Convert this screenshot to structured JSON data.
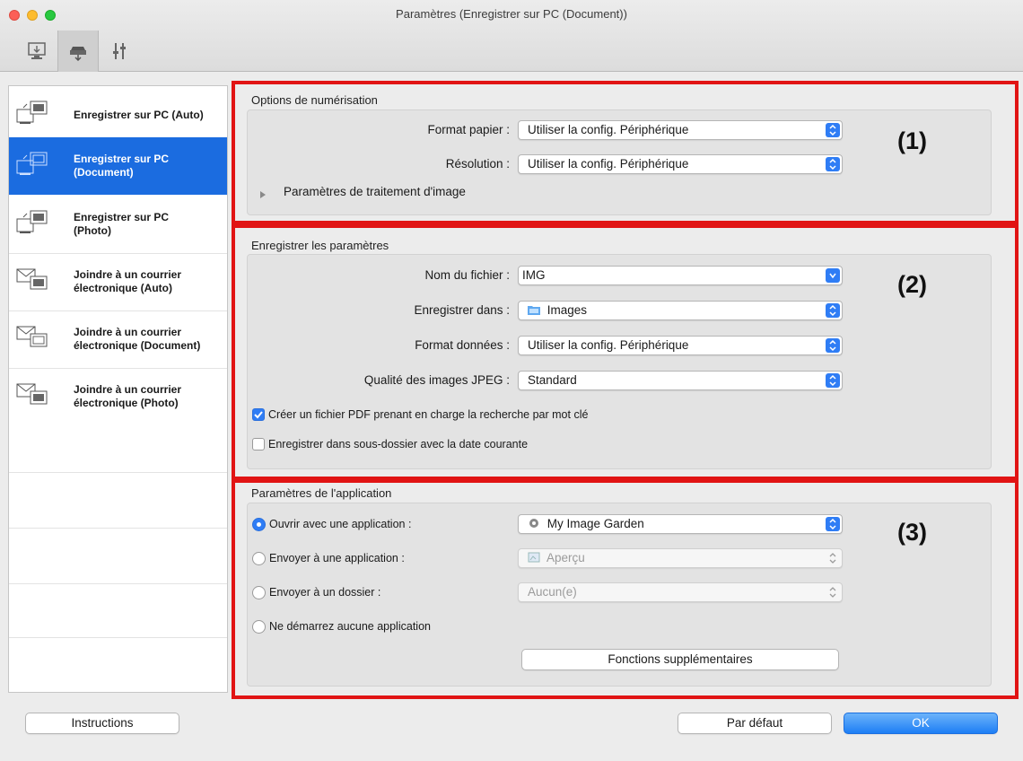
{
  "window": {
    "title": "Paramètres (Enregistrer sur PC (Document))"
  },
  "toolbar": {
    "tabs": [
      {
        "icon": "scan-from-computer-icon"
      },
      {
        "icon": "scan-from-operation-panel-icon",
        "active": true
      },
      {
        "icon": "general-settings-icon"
      }
    ]
  },
  "sidebar": {
    "items": [
      {
        "label": "Enregistrer sur PC (Auto)",
        "icon": "save-to-pc-icon"
      },
      {
        "label": "Enregistrer sur PC\n(Document)",
        "icon": "save-to-pc-document-icon",
        "selected": true
      },
      {
        "label": "Enregistrer sur PC\n(Photo)",
        "icon": "save-to-pc-photo-icon"
      },
      {
        "label": "Joindre à un courrier\nélectronique (Auto)",
        "icon": "attach-email-icon"
      },
      {
        "label": "Joindre à un courrier\nélectronique (Document)",
        "icon": "attach-email-document-icon"
      },
      {
        "label": "Joindre à un courrier\nélectronique (Photo)",
        "icon": "attach-email-photo-icon"
      }
    ]
  },
  "scan_options": {
    "title": "Options de numérisation",
    "marker": "(1)",
    "paper_size_label": "Format papier :",
    "paper_size_value": "Utiliser la config. Périphérique",
    "resolution_label": "Résolution :",
    "resolution_value": "Utiliser la config. Périphérique",
    "image_processing_label": "Paramètres de traitement d'image"
  },
  "save_settings": {
    "title": "Enregistrer les paramètres",
    "marker": "(2)",
    "filename_label": "Nom du fichier :",
    "filename_value": "IMG",
    "save_in_label": "Enregistrer dans :",
    "save_in_value": "Images",
    "data_format_label": "Format données :",
    "data_format_value": "Utiliser la config. Périphérique",
    "jpeg_quality_label": "Qualité des images JPEG :",
    "jpeg_quality_value": "Standard",
    "pdf_keyword_label": "Créer un fichier PDF prenant en charge la recherche par mot clé",
    "pdf_keyword_checked": true,
    "subfolder_label": "Enregistrer dans sous-dossier avec la date courante",
    "subfolder_checked": false
  },
  "app_settings": {
    "title": "Paramètres de l'application",
    "marker": "(3)",
    "open_with_label": "Ouvrir avec une application :",
    "open_with_value": "My Image Garden",
    "send_to_app_label": "Envoyer à une application :",
    "send_to_app_value": "Aperçu",
    "send_to_folder_label": "Envoyer à un dossier :",
    "send_to_folder_value": "Aucun(e)",
    "no_app_label": "Ne démarrez aucune application",
    "selected_option": "open_with",
    "more_functions_label": "Fonctions supplémentaires"
  },
  "footer": {
    "instructions_label": "Instructions",
    "defaults_label": "Par défaut",
    "ok_label": "OK"
  },
  "colors": {
    "highlight_border": "#e11414",
    "accent": "#2f7df5",
    "selection": "#1b6ce0"
  }
}
